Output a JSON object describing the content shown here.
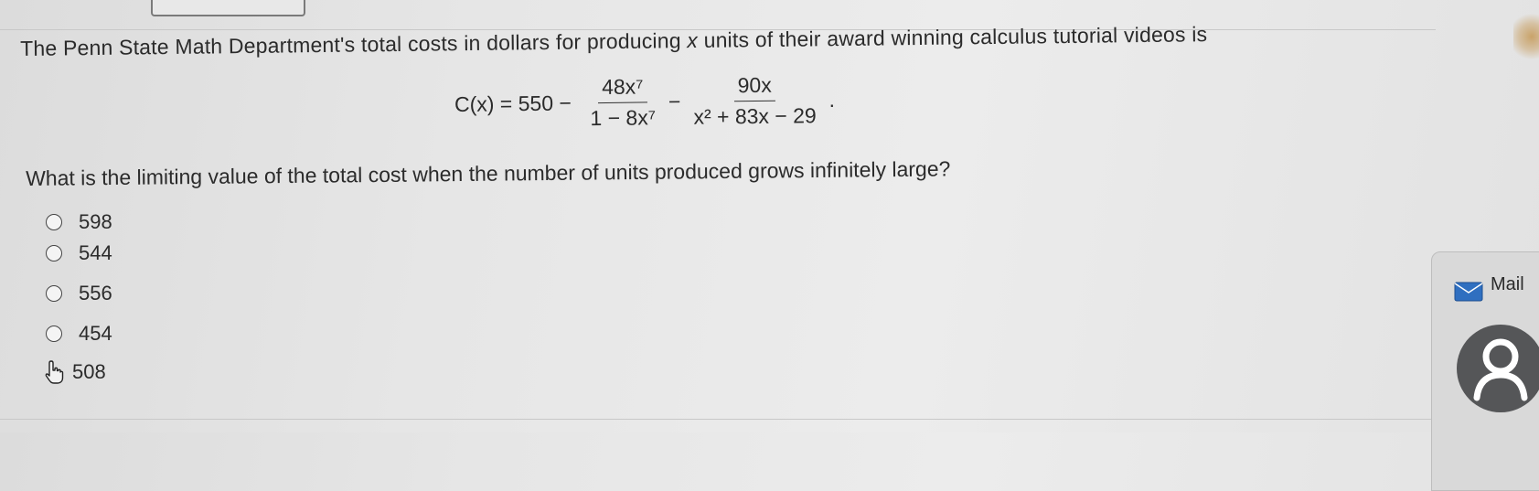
{
  "question": {
    "text_before": "The Penn State Math Department's total costs in dollars for producing ",
    "var": "x",
    "text_after": " units of their award winning calculus tutorial videos is"
  },
  "formula": {
    "lhs": "C(x) = 550 − ",
    "frac1_num": "48x⁷",
    "frac1_den": "1 − 8x⁷",
    "minus": "−",
    "frac2_num": "90x",
    "frac2_den": "x² + 83x − 29",
    "end": "."
  },
  "prompt": "What is the limiting value of the total cost when the number of units produced grows infinitely large?",
  "options": [
    "598",
    "544",
    "556",
    "454",
    "508"
  ],
  "sidebar": {
    "mail_label": "Mail"
  },
  "icons": {
    "mail": "mail-icon",
    "avatar": "person-icon",
    "cursor": "hand-pointer-icon"
  }
}
